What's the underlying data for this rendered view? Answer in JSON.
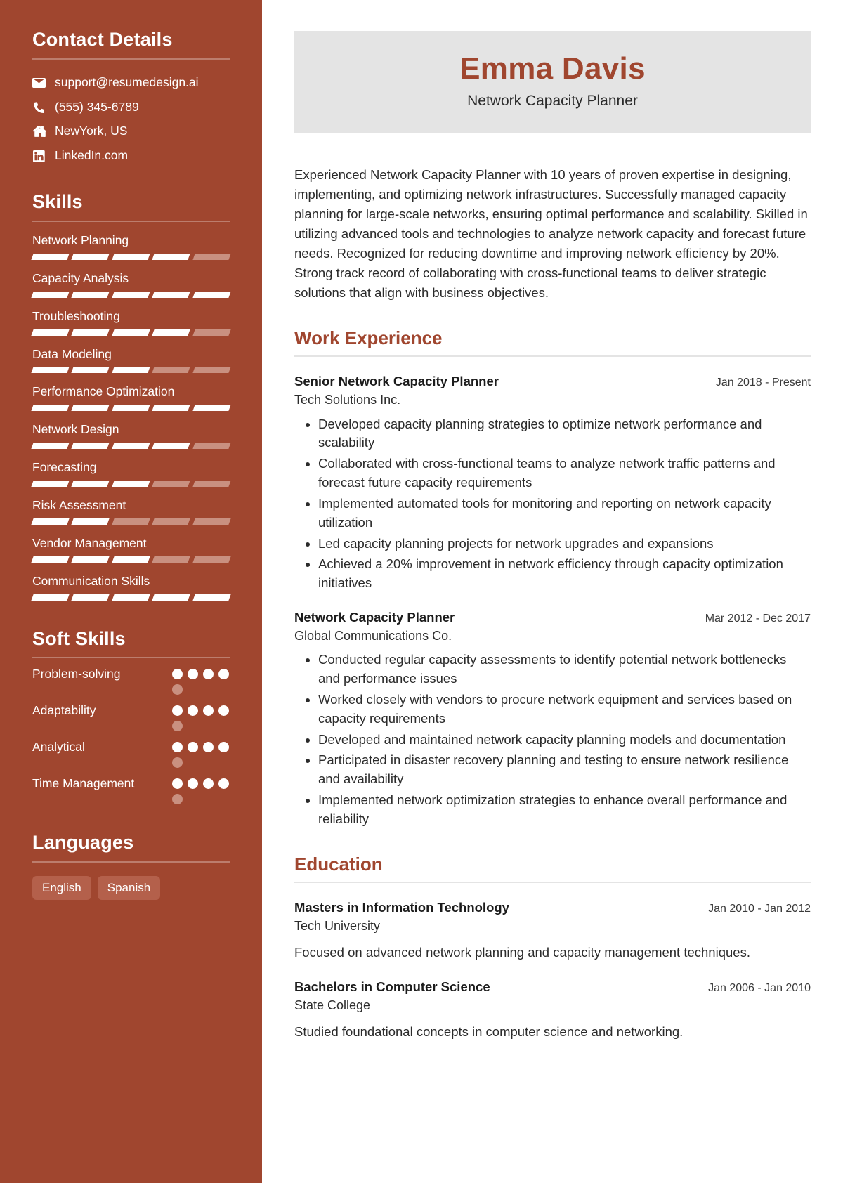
{
  "theme": {
    "sidebar_bg": "#a0462f",
    "accent": "#a0462f",
    "header_bg": "#e4e4e4",
    "muted_bar": "#c99080",
    "pill_bg": "#b4604b"
  },
  "sidebar": {
    "contact": {
      "heading": "Contact Details",
      "items": [
        {
          "icon": "envelope-icon",
          "text": "support@resumedesign.ai"
        },
        {
          "icon": "phone-icon",
          "text": "(555) 345-6789"
        },
        {
          "icon": "home-icon",
          "text": "NewYork, US"
        },
        {
          "icon": "linkedin-icon",
          "text": "LinkedIn.com"
        }
      ]
    },
    "skills": {
      "heading": "Skills",
      "max": 5,
      "items": [
        {
          "name": "Network Planning",
          "level": 4
        },
        {
          "name": "Capacity Analysis",
          "level": 5
        },
        {
          "name": "Troubleshooting",
          "level": 4
        },
        {
          "name": "Data Modeling",
          "level": 3
        },
        {
          "name": "Performance Optimization",
          "level": 5
        },
        {
          "name": "Network Design",
          "level": 4
        },
        {
          "name": "Forecasting",
          "level": 3
        },
        {
          "name": "Risk Assessment",
          "level": 2
        },
        {
          "name": "Vendor Management",
          "level": 3
        },
        {
          "name": "Communication Skills",
          "level": 5
        }
      ]
    },
    "soft_skills": {
      "heading": "Soft Skills",
      "max": 5,
      "items": [
        {
          "name": "Problem-solving",
          "level": 4
        },
        {
          "name": "Adaptability",
          "level": 4
        },
        {
          "name": "Analytical",
          "level": 4
        },
        {
          "name": "Time Management",
          "level": 4
        }
      ]
    },
    "languages": {
      "heading": "Languages",
      "items": [
        "English",
        "Spanish"
      ]
    }
  },
  "header": {
    "name": "Emma Davis",
    "title": "Network Capacity Planner"
  },
  "summary": "Experienced Network Capacity Planner with 10 years of proven expertise in designing, implementing, and optimizing network infrastructures. Successfully managed capacity planning for large-scale networks, ensuring optimal performance and scalability. Skilled in utilizing advanced tools and technologies to analyze network capacity and forecast future needs. Recognized for reducing downtime and improving network efficiency by 20%. Strong track record of collaborating with cross-functional teams to deliver strategic solutions that align with business objectives.",
  "work": {
    "heading": "Work Experience",
    "entries": [
      {
        "title": "Senior Network Capacity Planner",
        "org": "Tech Solutions Inc.",
        "date": "Jan 2018 - Present",
        "bullets": [
          "Developed capacity planning strategies to optimize network performance and scalability",
          "Collaborated with cross-functional teams to analyze network traffic patterns and forecast future capacity requirements",
          "Implemented automated tools for monitoring and reporting on network capacity utilization",
          "Led capacity planning projects for network upgrades and expansions",
          "Achieved a 20% improvement in network efficiency through capacity optimization initiatives"
        ]
      },
      {
        "title": "Network Capacity Planner",
        "org": "Global Communications Co.",
        "date": "Mar 2012 - Dec 2017",
        "bullets": [
          "Conducted regular capacity assessments to identify potential network bottlenecks and performance issues",
          "Worked closely with vendors to procure network equipment and services based on capacity requirements",
          "Developed and maintained network capacity planning models and documentation",
          "Participated in disaster recovery planning and testing to ensure network resilience and availability",
          "Implemented network optimization strategies to enhance overall performance and reliability"
        ]
      }
    ]
  },
  "education": {
    "heading": "Education",
    "entries": [
      {
        "title": "Masters in Information Technology",
        "org": "Tech University",
        "date": "Jan 2010 - Jan 2012",
        "desc": "Focused on advanced network planning and capacity management techniques."
      },
      {
        "title": "Bachelors in Computer Science",
        "org": "State College",
        "date": "Jan 2006 - Jan 2010",
        "desc": "Studied foundational concepts in computer science and networking."
      }
    ]
  }
}
